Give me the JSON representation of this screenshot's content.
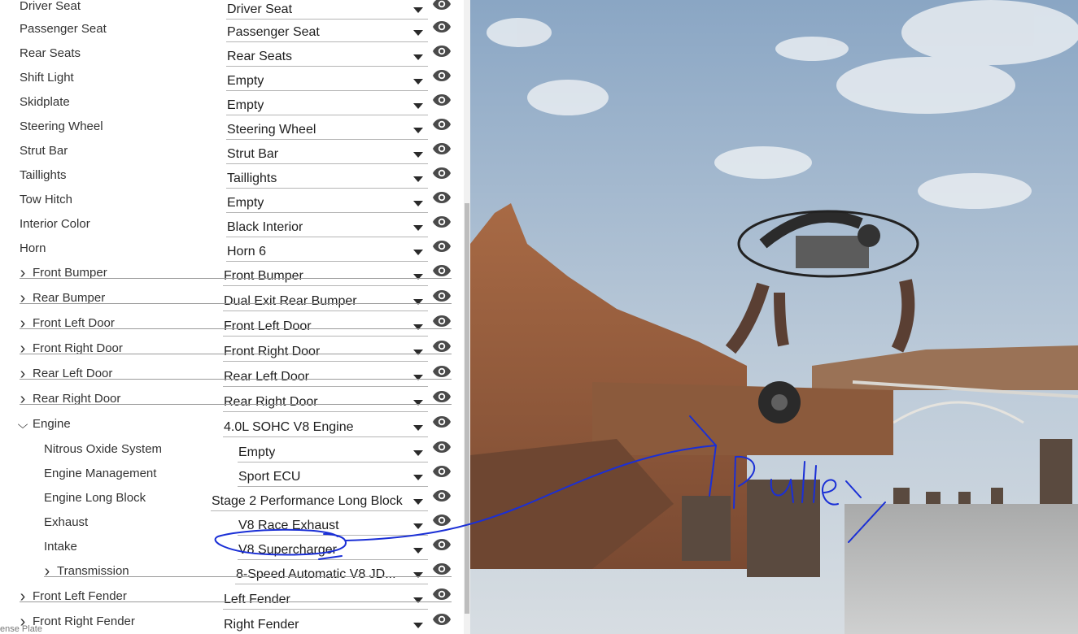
{
  "parts": [
    {
      "label": "Driver Seat",
      "value": "Driver Seat"
    },
    {
      "label": "Passenger Seat",
      "value": "Passenger Seat"
    },
    {
      "label": "Rear Seats",
      "value": "Rear Seats"
    },
    {
      "label": "Shift Light",
      "value": "Empty"
    },
    {
      "label": "Skidplate",
      "value": "Empty"
    },
    {
      "label": "Steering Wheel",
      "value": "Steering Wheel"
    },
    {
      "label": "Strut Bar",
      "value": "Strut Bar"
    },
    {
      "label": "Taillights",
      "value": "Taillights"
    },
    {
      "label": "Tow Hitch",
      "value": "Empty"
    },
    {
      "label": "Interior Color",
      "value": "Black Interior"
    },
    {
      "label": "Horn",
      "value": "Horn 6"
    },
    {
      "label": "Front Bumper",
      "value": "Front Bumper"
    },
    {
      "label": "Rear Bumper",
      "value": "Dual Exit Rear Bumper"
    },
    {
      "label": "Front Left Door",
      "value": "Front Left Door"
    },
    {
      "label": "Front Right Door",
      "value": "Front Right Door"
    },
    {
      "label": "Rear Left Door",
      "value": "Rear Left Door"
    },
    {
      "label": "Rear Right Door",
      "value": "Rear Right Door"
    },
    {
      "label": "Engine",
      "value": "4.0L SOHC V8 Engine"
    },
    {
      "label": "Nitrous Oxide System",
      "value": "Empty"
    },
    {
      "label": "Engine Management",
      "value": "Sport ECU"
    },
    {
      "label": "Engine Long Block",
      "value": "Stage 2 Performance Long Block"
    },
    {
      "label": "Exhaust",
      "value": "V8 Race Exhaust"
    },
    {
      "label": "Intake",
      "value": "V8 Supercharger"
    },
    {
      "label": "Transmission",
      "value": "8-Speed Automatic V8 JD..."
    },
    {
      "label": "Front Left Fender",
      "value": "Left Fender"
    },
    {
      "label": "Front Right Fender",
      "value": "Right Fender"
    }
  ],
  "footer_text": "ense Plate",
  "icons": {
    "expand": "chevron-right-icon",
    "collapse": "chevron-down-icon",
    "visibility": "eye-icon",
    "dropdown": "caret-down-icon"
  },
  "annotation": {
    "text": "Pulley",
    "color": "#1a2fd6"
  }
}
